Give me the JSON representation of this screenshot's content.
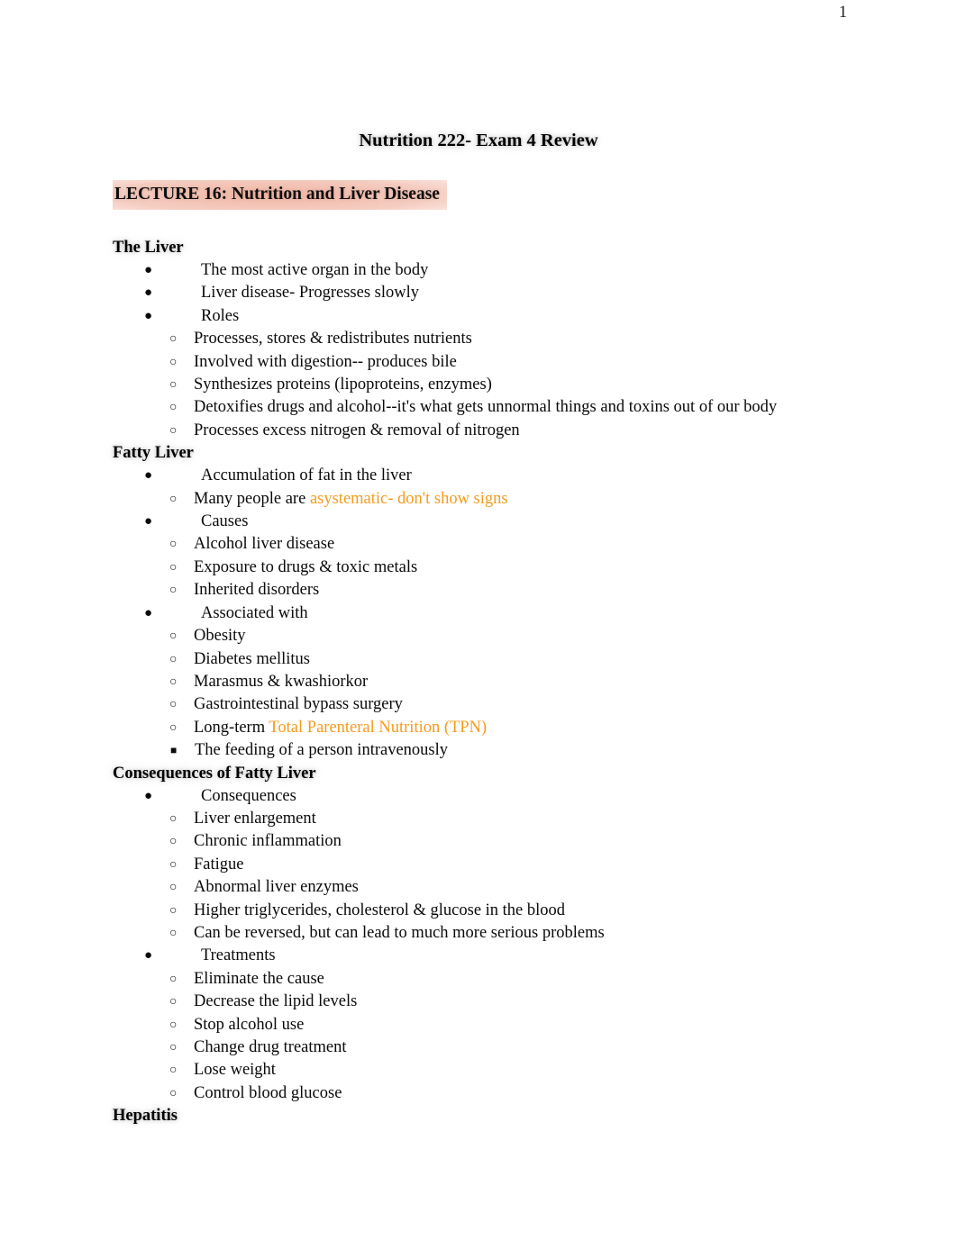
{
  "page": {
    "page_number": "1",
    "title": "Nutrition 222- Exam 4 Review"
  },
  "colors": {
    "accent_orange": "#f59b1e",
    "lecture_highlight_pink": "#f0b2a0",
    "text_black": "#000000"
  },
  "icons": {
    "disc_bullet": "●",
    "circle_bullet": "○",
    "square_bullet": "■"
  },
  "lecture": {
    "heading": "LECTURE 16: Nutrition and Liver Disease"
  },
  "sections": {
    "the_liver": {
      "heading": "The Liver",
      "items": [
        "The most active organ in the body",
        "Liver disease- Progresses slowly",
        "Roles"
      ],
      "roles": [
        "Processes, stores & redistributes nutrients",
        "Involved with digestion-- produces bile",
        "Synthesizes proteins (lipoproteins, enzymes)",
        "Detoxifies drugs and alcohol--it's what gets unnormal things and toxins out of our body",
        "Processes excess nitrogen & removal of nitrogen"
      ]
    },
    "fatty_liver": {
      "heading": "Fatty Liver",
      "accumulation": "Accumulation of fat in the liver",
      "asymptomatic_prefix": "Many people are ",
      "asymptomatic_accent": "asystematic- don't show signs",
      "causes_label": "Causes",
      "causes": [
        "Alcohol liver disease",
        "Exposure to drugs & toxic metals",
        "Inherited disorders"
      ],
      "associated_label": "Associated with",
      "associated": [
        "Obesity",
        "Diabetes mellitus",
        "Marasmus & kwashiorkor",
        "Gastrointestinal bypass surgery"
      ],
      "tpn_prefix": "Long-term ",
      "tpn_accent": "Total Parenteral Nutrition (TPN)",
      "tpn_sub": "The feeding of a person intravenously"
    },
    "consequences_of_fatty_liver": {
      "heading": "Consequences of Fatty Liver",
      "consequences_label": "Consequences",
      "consequences": [
        "Liver enlargement",
        "Chronic inflammation",
        "Fatigue",
        "Abnormal liver enzymes",
        "Higher triglycerides, cholesterol & glucose in the blood",
        "Can be reversed, but can lead to much more serious problems"
      ],
      "treatments_label": "Treatments",
      "treatments": [
        "Eliminate the cause",
        "Decrease the lipid levels",
        "Stop alcohol use",
        "Change drug treatment",
        "Lose weight",
        "Control blood glucose"
      ]
    },
    "hepatitis": {
      "heading": "Hepatitis"
    }
  }
}
